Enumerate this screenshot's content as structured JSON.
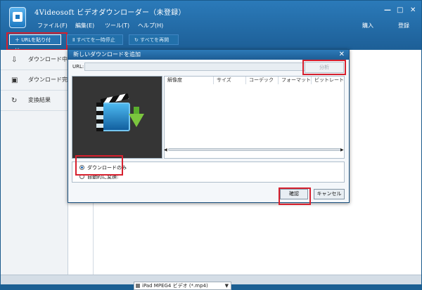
{
  "app": {
    "title": "4Videosoft ビデオダウンローダー（未登録）",
    "menus": [
      "ファイル(F)",
      "編集(E)",
      "ツール(T)",
      "ヘルプ(H)"
    ],
    "right_menu": [
      "購入",
      "登録"
    ],
    "window_controls": [
      "—",
      "□",
      "✕"
    ]
  },
  "toolbar": {
    "paste_url": "URLを貼り付け",
    "pause_all": "すべてを一時停止",
    "resume_all": "すべてを再開"
  },
  "sidebar": {
    "items": [
      {
        "label": "ダウンロード中",
        "icon": "download-icon"
      },
      {
        "label": "ダウンロード完了",
        "icon": "download-complete-icon"
      },
      {
        "label": "変換結果",
        "icon": "convert-result-icon"
      }
    ]
  },
  "dialog": {
    "title": "新しいダウンロードを追加",
    "url_label": "URL:",
    "url_value": "",
    "analyze_button": "分析",
    "columns": [
      "解像度",
      "サイズ",
      "コーデック",
      "フォーマット",
      "ビットレート"
    ],
    "options": {
      "download_only": "ダウンロードのみ",
      "auto_convert": "自動的に変換:"
    },
    "selected_format": "iPad MPEG4 ビデオ (*.mp4)",
    "confirm_button": "確認",
    "cancel_button": "キャンセル"
  },
  "colors": {
    "accent": "#1f68b2",
    "highlight_red": "#d7202e",
    "title_blue": "#2b7ab9"
  }
}
